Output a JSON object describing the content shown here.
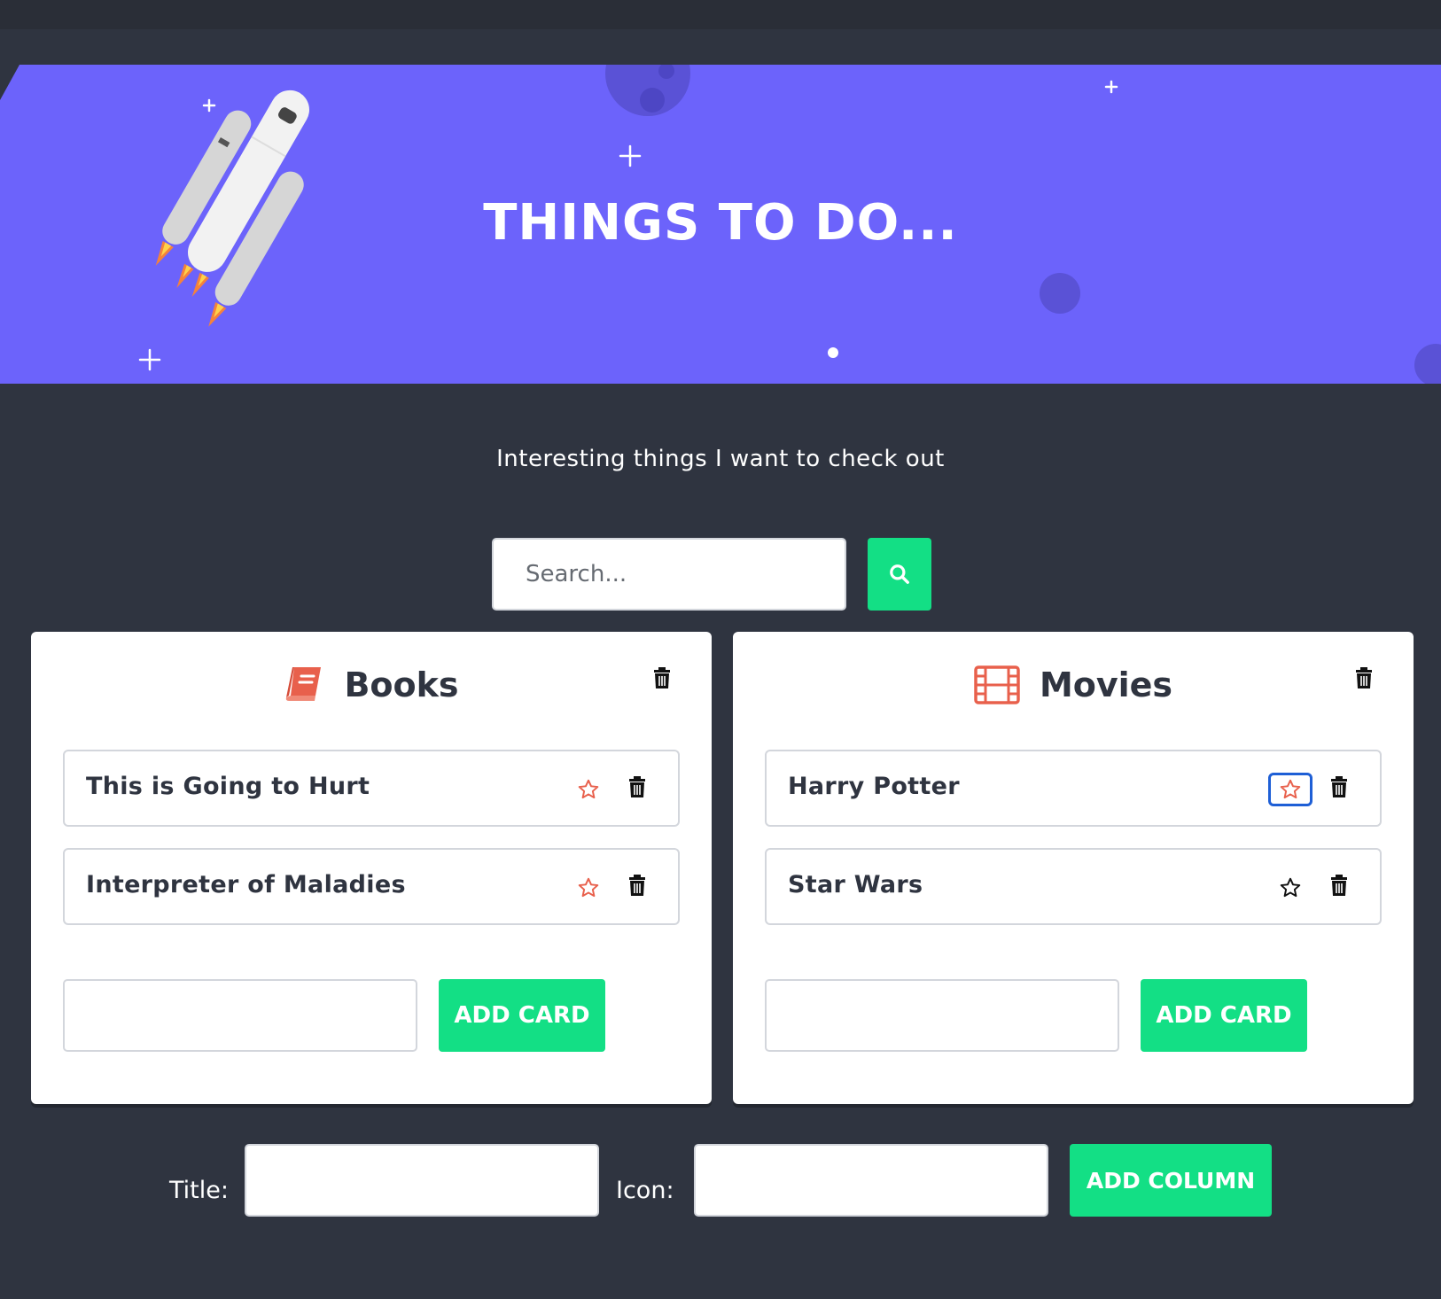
{
  "hero": {
    "title": "THINGS TO DO..."
  },
  "subtitle": "Interesting things I want to check out",
  "search": {
    "placeholder": "Search...",
    "button_icon": "search-icon"
  },
  "columns": [
    {
      "title": "Books",
      "icon": "book-icon",
      "cards": [
        {
          "title": "This is Going to Hurt",
          "starred": false
        },
        {
          "title": "Interpreter of Maladies",
          "starred": false
        }
      ],
      "add_card_label": "ADD CARD",
      "new_card_value": ""
    },
    {
      "title": "Movies",
      "icon": "film-icon",
      "cards": [
        {
          "title": "Harry Potter",
          "starred": false,
          "focused": true
        },
        {
          "title": "Star Wars",
          "starred": false
        }
      ],
      "add_card_label": "ADD CARD",
      "new_card_value": ""
    }
  ],
  "footer_form": {
    "title_label": "Title:",
    "title_value": "",
    "icon_label": "Icon:",
    "icon_value": "",
    "add_column_label": "ADD COLUMN"
  },
  "colors": {
    "background": "#2f3440",
    "hero": "#6c63fb",
    "accent_green": "#13df85",
    "icon_red": "#e8604c",
    "focus_blue": "#1e5fd6"
  }
}
